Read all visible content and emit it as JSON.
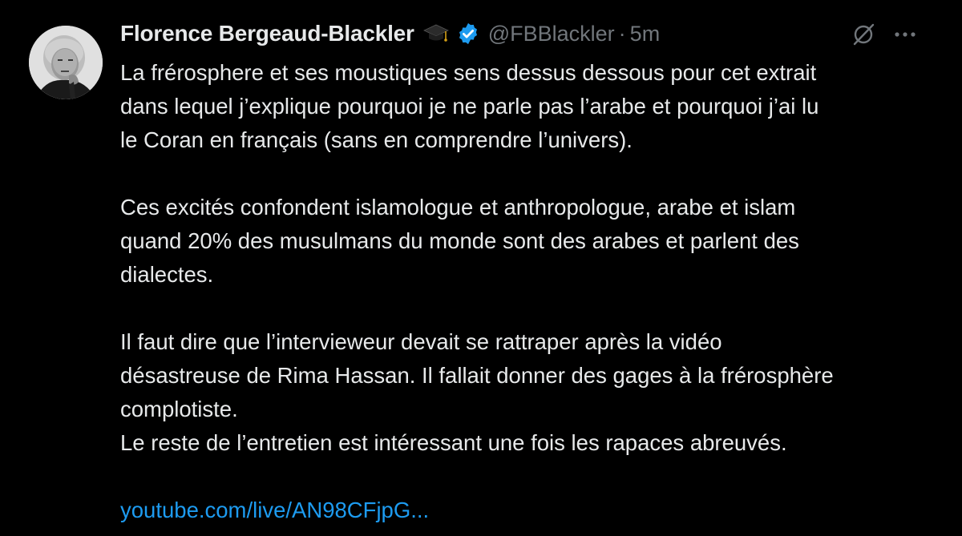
{
  "tweet": {
    "author": {
      "display_name": "Florence Bergeaud-Blackler",
      "name_emoji": "graduation-cap",
      "verified": true,
      "handle": "@FBBlackler",
      "separator": "·",
      "time": "5m"
    },
    "body": {
      "paragraph1": [
        "La frérosphere et ses moustiques sens dessus dessous pour cet extrait",
        "dans lequel j’explique pourquoi je ne parle pas l’arabe et pourquoi j’ai lu",
        "le Coran en français (sans en comprendre l’univers)."
      ],
      "paragraph2": [
        "Ces excités confondent islamologue et anthropologue, arabe et islam",
        "quand 20% des musulmans du monde sont des arabes et parlent des",
        "dialectes."
      ],
      "paragraph3": [
        "Il faut dire que l’intervieweur devait se rattraper après la vidéo",
        "désastreuse de Rima Hassan. Il fallait donner des gages à la frérosphère",
        "complotiste.",
        "Le reste de l’entretien est intéressant une fois les rapaces abreuvés."
      ],
      "link": "youtube.com/live/AN98CFjpG..."
    },
    "icons": {
      "avatar": "avatar-photo",
      "grok": "grok-icon",
      "more": "more-icon"
    }
  },
  "colors": {
    "background": "#000000",
    "text": "#e7e9ea",
    "muted": "#71767b",
    "link": "#1d9bf0",
    "verified": "#1d9bf0"
  }
}
